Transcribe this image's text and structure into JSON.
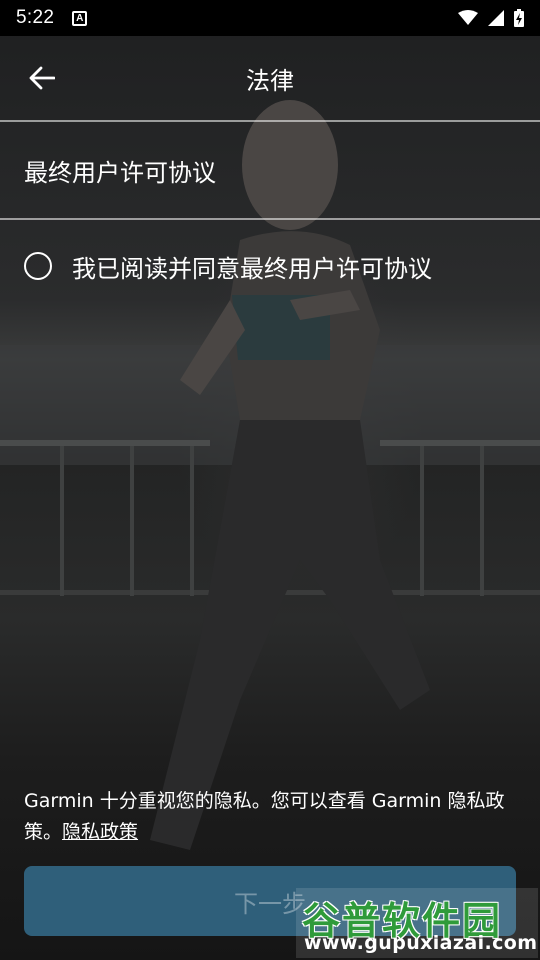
{
  "status_bar": {
    "time": "5:22",
    "notification_icon": "A"
  },
  "app_bar": {
    "title": "法律",
    "back_icon": "arrow-left-icon"
  },
  "eula": {
    "label": "最终用户许可协议"
  },
  "agreement": {
    "label": "我已阅读并同意最终用户许可协议",
    "checked": false
  },
  "privacy": {
    "text": "Garmin 十分重视您的隐私。您可以查看 Garmin 隐私政策。",
    "link_label": "隐私政策"
  },
  "next_button": {
    "label": "下一步",
    "enabled": false
  },
  "watermark": {
    "title": "谷普软件园",
    "url": "www.gupuxiazai.com"
  },
  "colors": {
    "button_bg": "#2f5f7a",
    "watermark_green": "#2f9b3a"
  }
}
